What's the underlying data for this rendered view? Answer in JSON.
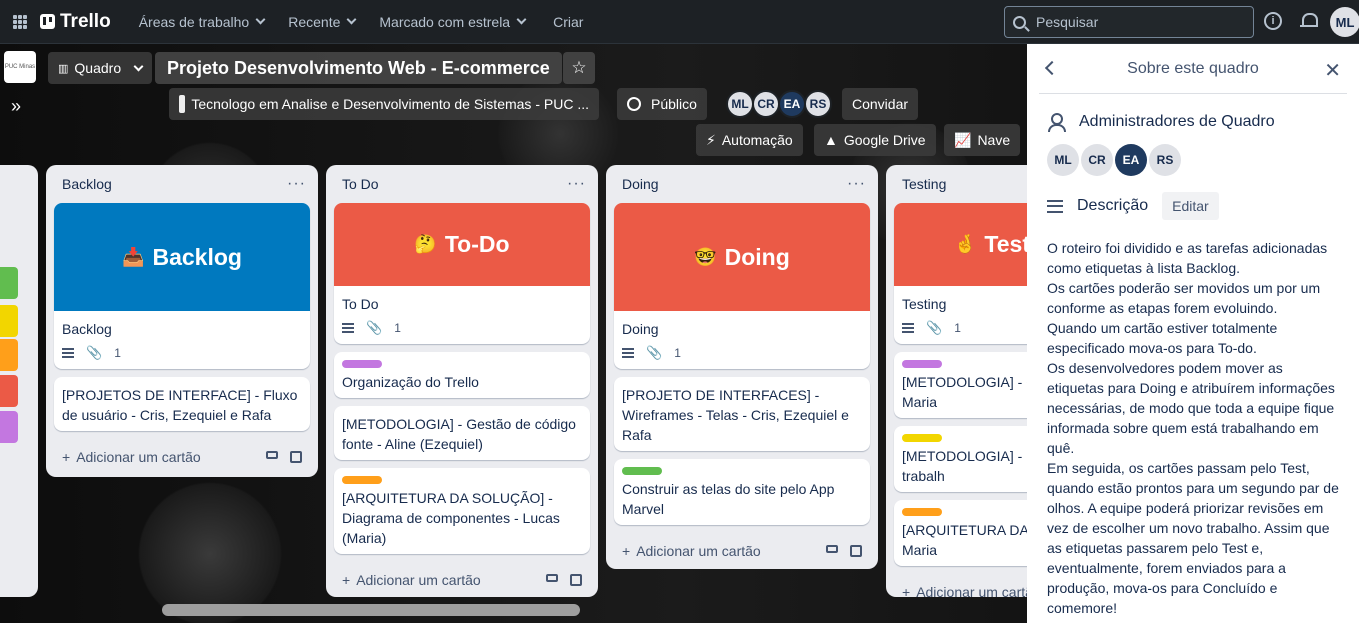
{
  "topnav": {
    "brand": "Trello",
    "workspaces": "Áreas de trabalho",
    "recent": "Recente",
    "starred": "Marcado com estrela",
    "create": "Criar",
    "search_placeholder": "Pesquisar",
    "user_initials": "ML"
  },
  "board": {
    "view_label": "Quadro",
    "title": "Projeto Desenvolvimento Web - E-commerce",
    "workspace_name": "Tecnologo em Analise e Desenvolvimento de Sistemas - PUC ...",
    "visibility": "Público",
    "members": [
      "ML",
      "CR",
      "EA",
      "RS"
    ],
    "share": "Convidar",
    "automation": "Automação",
    "google_drive": "Google Drive",
    "nave": "Nave",
    "workspace_logo_text": "PUC Minas"
  },
  "lists": [
    {
      "title": "Backlog",
      "cover_text": "Backlog",
      "cover_emoji": "📥",
      "first_card": "Backlog",
      "attachments": "1",
      "cards": [
        {
          "text": "[PROJETOS DE INTERFACE] - Fluxo de usuário - Cris, Ezequiel e Rafa"
        }
      ],
      "add_card": "Adicionar um cartão"
    },
    {
      "title": "To Do",
      "cover_text": "To-Do",
      "cover_emoji": "🤔",
      "first_card": "To Do",
      "attachments": "1",
      "cards": [
        {
          "text": "Organização do Trello",
          "label": "#c377e0"
        },
        {
          "text": "[METODOLOGIA] - Gestão de código fonte - Aline (Ezequiel)"
        },
        {
          "text": "[ARQUITETURA DA SOLUÇÃO] - Diagrama de componentes - Lucas (Maria)",
          "label": "#ff9f1a"
        }
      ],
      "add_card": "Adicionar um cartão"
    },
    {
      "title": "Doing",
      "cover_text": "Doing",
      "cover_emoji": "🤓",
      "first_card": "Doing",
      "attachments": "1",
      "cards": [
        {
          "text": "[PROJETO DE INTERFACES] - Wireframes - Telas - Cris, Ezequiel e Rafa"
        },
        {
          "text": "Construir as telas do site pelo App Marvel",
          "label": "#61bd4f"
        }
      ],
      "add_card": "Adicionar um cartão"
    },
    {
      "title": "Testing",
      "cover_text": "Test",
      "cover_emoji": "🤞",
      "first_card": "Testing",
      "attachments": "1",
      "cards": [
        {
          "text": "[METODOLOGIA] - G do projeto - Maria",
          "label": "#c377e0"
        },
        {
          "text": "[METODOLOGIA] - R ambiente de trabalh",
          "label": "#f2d600"
        },
        {
          "text": "[ARQUITETURA DA S Hospedagem - Maria",
          "label": "#ff9f1a"
        }
      ],
      "add_card": "Adicionar um cartão"
    }
  ],
  "panel": {
    "title": "Sobre este quadro",
    "admins_title": "Administradores de Quadro",
    "admins": [
      "ML",
      "CR",
      "EA",
      "RS"
    ],
    "description_title": "Descrição",
    "edit_label": "Editar",
    "description": [
      "O roteiro foi dividido e as tarefas adicionadas como etiquetas à lista Backlog.",
      "Os cartões poderão ser movidos um por um conforme as etapas forem evoluindo.",
      "Quando um cartão estiver totalmente especificado mova-os para To-do.",
      "Os desenvolvedores podem mover as etiquetas para Doing e atribuírem informações necessárias, de modo que toda a equipe fique informada sobre quem está trabalhando em quê.",
      "Em seguida, os cartões passam pelo Test, quando estão prontos para um segundo par de olhos. A equipe poderá priorizar revisões em vez de escolher um novo trabalho. Assim que as etiquetas passarem pelo Test e, eventualmente, forem enviados para a produção, mova-os para Concluído e comemore!"
    ]
  },
  "colors": {
    "nav_bg": "#1d2125",
    "list_bg": "#ebecf0",
    "backlog_cover": "#0079bf",
    "todo_cover": "#eb5a46",
    "label_purple": "#c377e0",
    "label_orange": "#ff9f1a",
    "label_green": "#61bd4f",
    "label_yellow": "#f2d600"
  }
}
